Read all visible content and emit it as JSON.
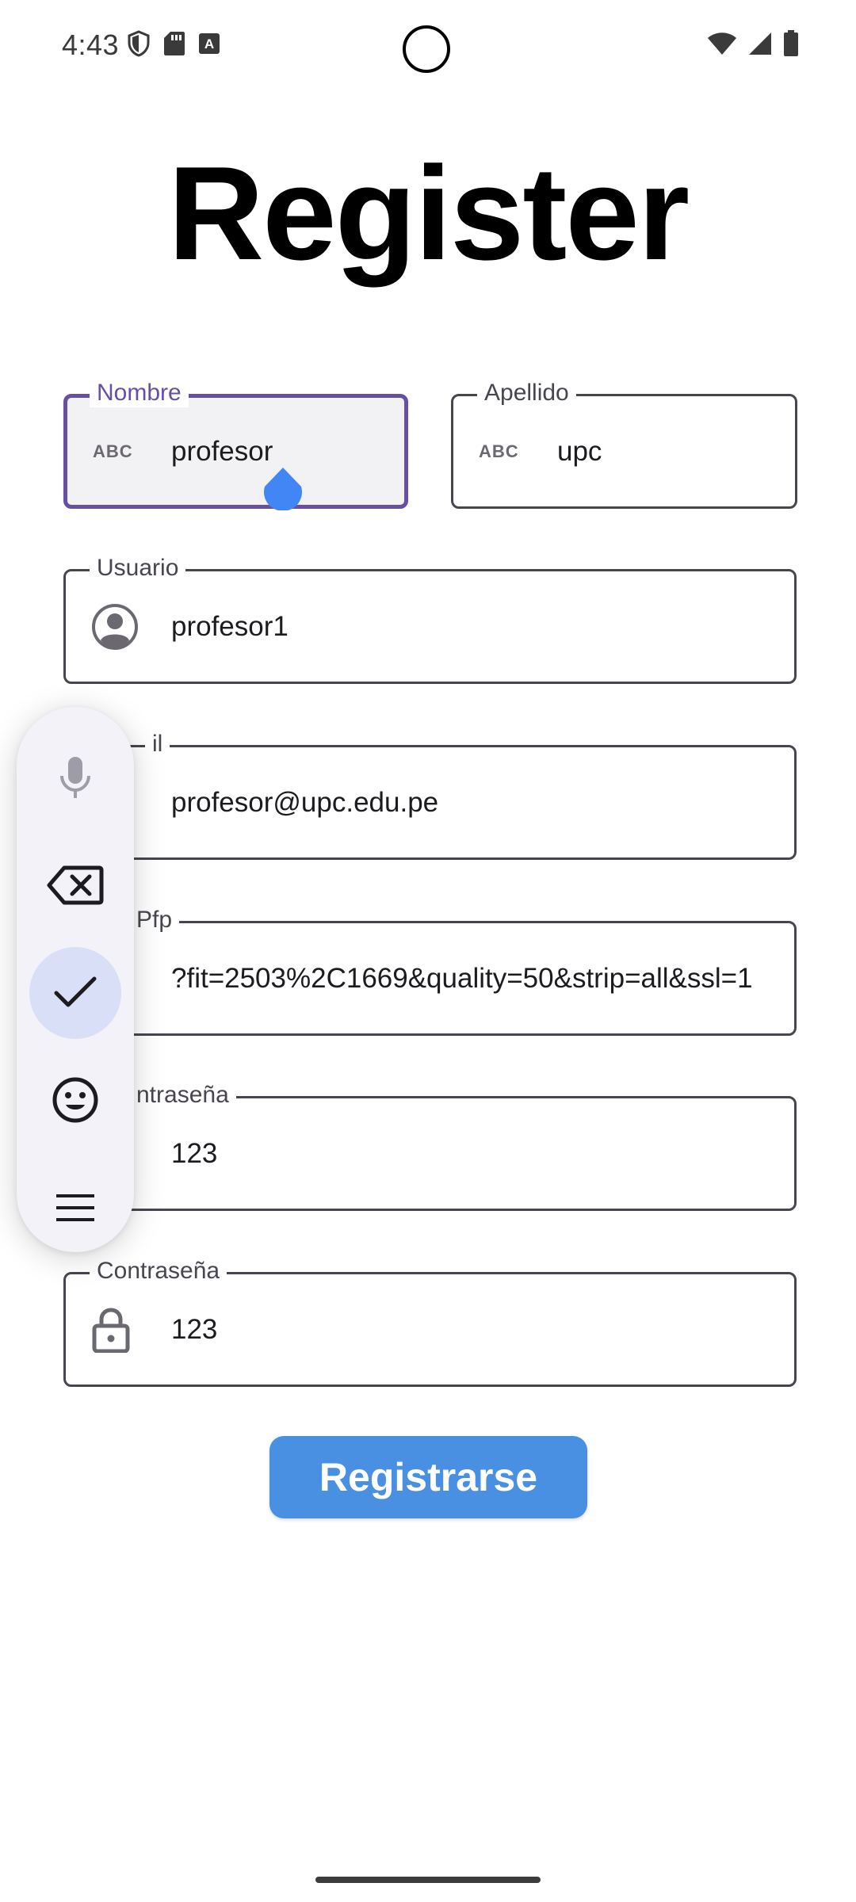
{
  "status_bar": {
    "time": "4:43",
    "left_icons": [
      "shield-icon",
      "sd-card-icon",
      "font-icon"
    ],
    "right_icons": [
      "wifi-icon",
      "signal-icon",
      "battery-icon"
    ]
  },
  "page": {
    "title": "Register"
  },
  "form": {
    "nombre": {
      "label": "Nombre",
      "value": "profesor",
      "icon": "abc-icon",
      "icon_text": "ABC",
      "focused": true
    },
    "apellido": {
      "label": "Apellido",
      "value": "upc",
      "icon": "abc-icon",
      "icon_text": "ABC"
    },
    "usuario": {
      "label": "Usuario",
      "value": "profesor1",
      "icon": "account-circle-icon"
    },
    "email": {
      "label": "il",
      "value": "profesor@upc.edu.pe"
    },
    "pfp": {
      "label": "Pfp",
      "value": "?fit=2503%2C1669&quality=50&strip=all&ssl=1"
    },
    "contrasena": {
      "label": "ntraseña",
      "value": "123"
    },
    "confirmar": {
      "label": "Contraseña",
      "value": "123",
      "icon": "lock-icon"
    }
  },
  "actions": {
    "register_label": "Registrarse"
  },
  "keyboard_toolbar": {
    "items": [
      "mic-icon",
      "backspace-icon",
      "check-icon",
      "emoji-icon",
      "menu-icon"
    ],
    "active": "check-icon"
  },
  "colors": {
    "focus": "#6750a4",
    "button": "#4a90e2",
    "cursor_handle": "#4285f4",
    "toolbar_bg": "#f3f2f9",
    "toolbar_active": "#d9dff7"
  }
}
